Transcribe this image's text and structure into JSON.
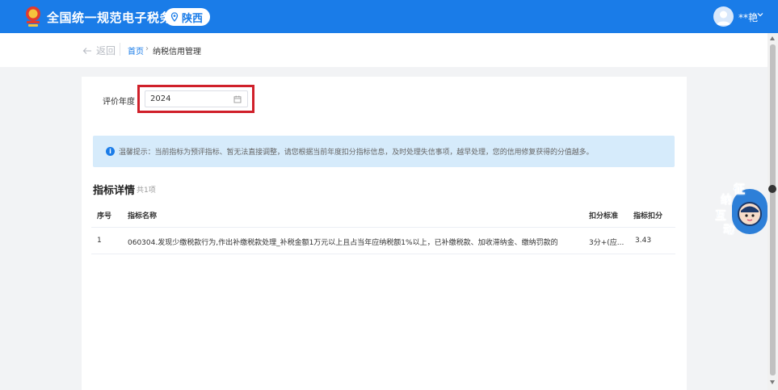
{
  "header": {
    "site_title": "全国统一规范电子税务局",
    "region": "陕西",
    "user_name": "**艳",
    "brand_color": "#1a7ce8"
  },
  "breadcrumb": {
    "back_label": "返回",
    "home": "首页",
    "separator": "›",
    "current": "纳税信用管理"
  },
  "filter": {
    "year_label": "评价年度",
    "year_value": "2024",
    "calendar_icon": "calendar-icon"
  },
  "notice": {
    "text": "温馨提示：当前指标为预评指标、暂无法直接调整，请您根据当前年度扣分指标信息，及时处理失信事项，越早处理，您的信用修复获得的分值越多。"
  },
  "section": {
    "title": "指标详情",
    "count": "共1项"
  },
  "table": {
    "columns": [
      "序号",
      "指标名称",
      "扣分标准",
      "指标扣分"
    ],
    "rows": [
      {
        "index": "1",
        "name": "060304.发现少缴税款行为,作出补缴税款处理_补税金额1万元以上且占当年应纳税额1%以上，已补缴税款、加收滞纳金、缴纳罚款的",
        "standard": "3分+(应...",
        "score": "3.43"
      }
    ]
  },
  "widget": {
    "chars": [
      "征",
      "纳",
      "互",
      "动"
    ]
  }
}
